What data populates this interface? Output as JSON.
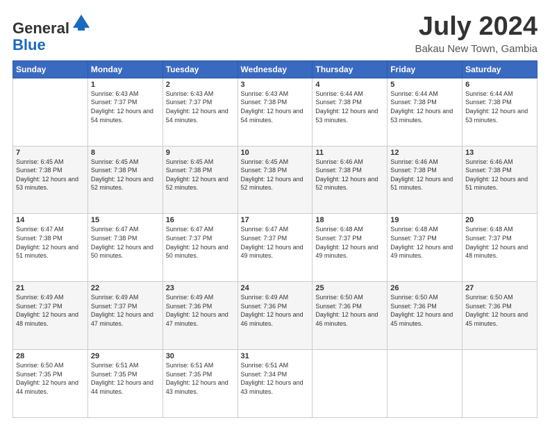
{
  "logo": {
    "general": "General",
    "blue": "Blue"
  },
  "header": {
    "month_year": "July 2024",
    "location": "Bakau New Town, Gambia"
  },
  "days_of_week": [
    "Sunday",
    "Monday",
    "Tuesday",
    "Wednesday",
    "Thursday",
    "Friday",
    "Saturday"
  ],
  "weeks": [
    [
      {
        "day": "",
        "sunrise": "",
        "sunset": "",
        "daylight": ""
      },
      {
        "day": "1",
        "sunrise": "6:43 AM",
        "sunset": "7:37 PM",
        "daylight": "12 hours and 54 minutes."
      },
      {
        "day": "2",
        "sunrise": "6:43 AM",
        "sunset": "7:37 PM",
        "daylight": "12 hours and 54 minutes."
      },
      {
        "day": "3",
        "sunrise": "6:43 AM",
        "sunset": "7:38 PM",
        "daylight": "12 hours and 54 minutes."
      },
      {
        "day": "4",
        "sunrise": "6:44 AM",
        "sunset": "7:38 PM",
        "daylight": "12 hours and 53 minutes."
      },
      {
        "day": "5",
        "sunrise": "6:44 AM",
        "sunset": "7:38 PM",
        "daylight": "12 hours and 53 minutes."
      },
      {
        "day": "6",
        "sunrise": "6:44 AM",
        "sunset": "7:38 PM",
        "daylight": "12 hours and 53 minutes."
      }
    ],
    [
      {
        "day": "7",
        "sunrise": "6:45 AM",
        "sunset": "7:38 PM",
        "daylight": "12 hours and 53 minutes."
      },
      {
        "day": "8",
        "sunrise": "6:45 AM",
        "sunset": "7:38 PM",
        "daylight": "12 hours and 52 minutes."
      },
      {
        "day": "9",
        "sunrise": "6:45 AM",
        "sunset": "7:38 PM",
        "daylight": "12 hours and 52 minutes."
      },
      {
        "day": "10",
        "sunrise": "6:45 AM",
        "sunset": "7:38 PM",
        "daylight": "12 hours and 52 minutes."
      },
      {
        "day": "11",
        "sunrise": "6:46 AM",
        "sunset": "7:38 PM",
        "daylight": "12 hours and 52 minutes."
      },
      {
        "day": "12",
        "sunrise": "6:46 AM",
        "sunset": "7:38 PM",
        "daylight": "12 hours and 51 minutes."
      },
      {
        "day": "13",
        "sunrise": "6:46 AM",
        "sunset": "7:38 PM",
        "daylight": "12 hours and 51 minutes."
      }
    ],
    [
      {
        "day": "14",
        "sunrise": "6:47 AM",
        "sunset": "7:38 PM",
        "daylight": "12 hours and 51 minutes."
      },
      {
        "day": "15",
        "sunrise": "6:47 AM",
        "sunset": "7:38 PM",
        "daylight": "12 hours and 50 minutes."
      },
      {
        "day": "16",
        "sunrise": "6:47 AM",
        "sunset": "7:37 PM",
        "daylight": "12 hours and 50 minutes."
      },
      {
        "day": "17",
        "sunrise": "6:47 AM",
        "sunset": "7:37 PM",
        "daylight": "12 hours and 49 minutes."
      },
      {
        "day": "18",
        "sunrise": "6:48 AM",
        "sunset": "7:37 PM",
        "daylight": "12 hours and 49 minutes."
      },
      {
        "day": "19",
        "sunrise": "6:48 AM",
        "sunset": "7:37 PM",
        "daylight": "12 hours and 49 minutes."
      },
      {
        "day": "20",
        "sunrise": "6:48 AM",
        "sunset": "7:37 PM",
        "daylight": "12 hours and 48 minutes."
      }
    ],
    [
      {
        "day": "21",
        "sunrise": "6:49 AM",
        "sunset": "7:37 PM",
        "daylight": "12 hours and 48 minutes."
      },
      {
        "day": "22",
        "sunrise": "6:49 AM",
        "sunset": "7:37 PM",
        "daylight": "12 hours and 47 minutes."
      },
      {
        "day": "23",
        "sunrise": "6:49 AM",
        "sunset": "7:36 PM",
        "daylight": "12 hours and 47 minutes."
      },
      {
        "day": "24",
        "sunrise": "6:49 AM",
        "sunset": "7:36 PM",
        "daylight": "12 hours and 46 minutes."
      },
      {
        "day": "25",
        "sunrise": "6:50 AM",
        "sunset": "7:36 PM",
        "daylight": "12 hours and 46 minutes."
      },
      {
        "day": "26",
        "sunrise": "6:50 AM",
        "sunset": "7:36 PM",
        "daylight": "12 hours and 45 minutes."
      },
      {
        "day": "27",
        "sunrise": "6:50 AM",
        "sunset": "7:36 PM",
        "daylight": "12 hours and 45 minutes."
      }
    ],
    [
      {
        "day": "28",
        "sunrise": "6:50 AM",
        "sunset": "7:35 PM",
        "daylight": "12 hours and 44 minutes."
      },
      {
        "day": "29",
        "sunrise": "6:51 AM",
        "sunset": "7:35 PM",
        "daylight": "12 hours and 44 minutes."
      },
      {
        "day": "30",
        "sunrise": "6:51 AM",
        "sunset": "7:35 PM",
        "daylight": "12 hours and 43 minutes."
      },
      {
        "day": "31",
        "sunrise": "6:51 AM",
        "sunset": "7:34 PM",
        "daylight": "12 hours and 43 minutes."
      },
      {
        "day": "",
        "sunrise": "",
        "sunset": "",
        "daylight": ""
      },
      {
        "day": "",
        "sunrise": "",
        "sunset": "",
        "daylight": ""
      },
      {
        "day": "",
        "sunrise": "",
        "sunset": "",
        "daylight": ""
      }
    ]
  ],
  "labels": {
    "sunrise": "Sunrise:",
    "sunset": "Sunset:",
    "daylight": "Daylight:"
  }
}
